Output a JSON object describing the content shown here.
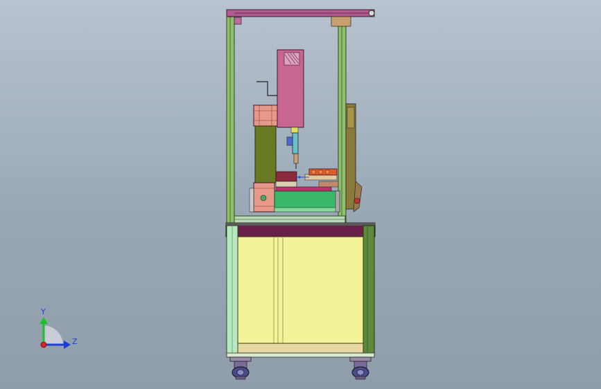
{
  "viewport": {
    "background_top": "#b7c3cf",
    "background_bottom": "#8f9dab"
  },
  "triad": {
    "y_label": "Y",
    "z_label": "Z",
    "y_color": "#1fbf2a",
    "z_color": "#1a3fd6",
    "x_color": "#e02020"
  },
  "colors": {
    "frame_profile": "#8fbf6a",
    "frame_top": "#9a3a7a",
    "cabinet_panel": "#f3f39a",
    "cabinet_side": "#5d8a3a",
    "cabinet_top": "#6a1f4a",
    "cabinet_base": "#e6d8a0",
    "spindle_housing": "#c8668f",
    "column_block": "#6a7a22",
    "gantry_plate": "#e79a8a",
    "slide_table": "#3ab86a",
    "workpiece": "#e05a2a",
    "caster": "#4a4a8a"
  }
}
